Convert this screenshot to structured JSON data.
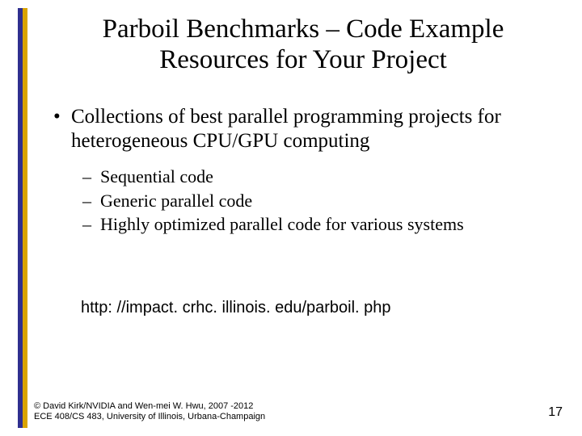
{
  "title": {
    "line1": "Parboil Benchmarks – Code Example",
    "line2": "Resources for Your Project"
  },
  "bullets": {
    "main": "Collections of best parallel programming projects for heterogeneous CPU/GPU computing",
    "sub": [
      "Sequential code",
      "Generic parallel code",
      "Highly optimized parallel code for various systems"
    ]
  },
  "url": "http: //impact. crhc. illinois. edu/parboil. php",
  "footer": {
    "line1": "© David Kirk/NVIDIA and Wen-mei W. Hwu, 2007 -2012",
    "line2": "ECE 408/CS 483, University of Illinois, Urbana-Champaign"
  },
  "page": "17"
}
